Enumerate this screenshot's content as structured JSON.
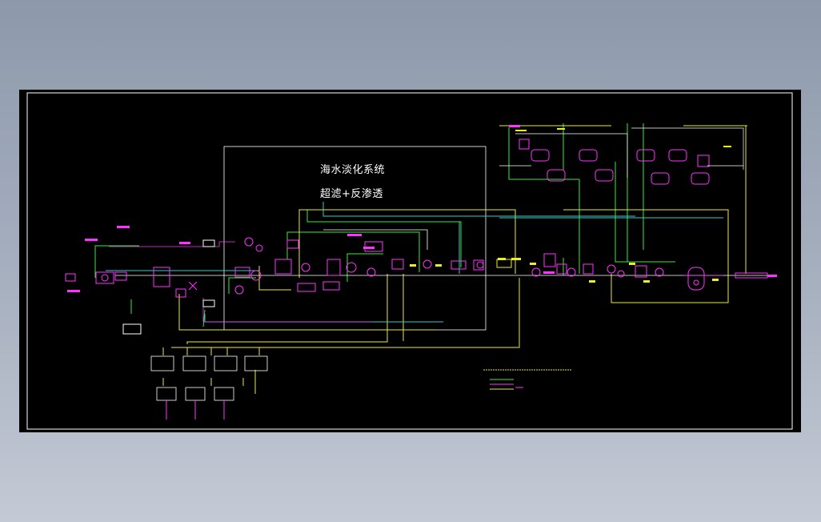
{
  "drawing": {
    "title_line1": "海水淡化系统",
    "title_line2": "超滤+反渗透"
  },
  "colors": {
    "background": "#000000",
    "frame": "#ffffff",
    "equipment": "#ff33ff",
    "pipe_green": "#33ee33",
    "pipe_yellow": "#eeee22",
    "pipe_cyan": "#33cccc",
    "instrument": "#ffff00"
  }
}
